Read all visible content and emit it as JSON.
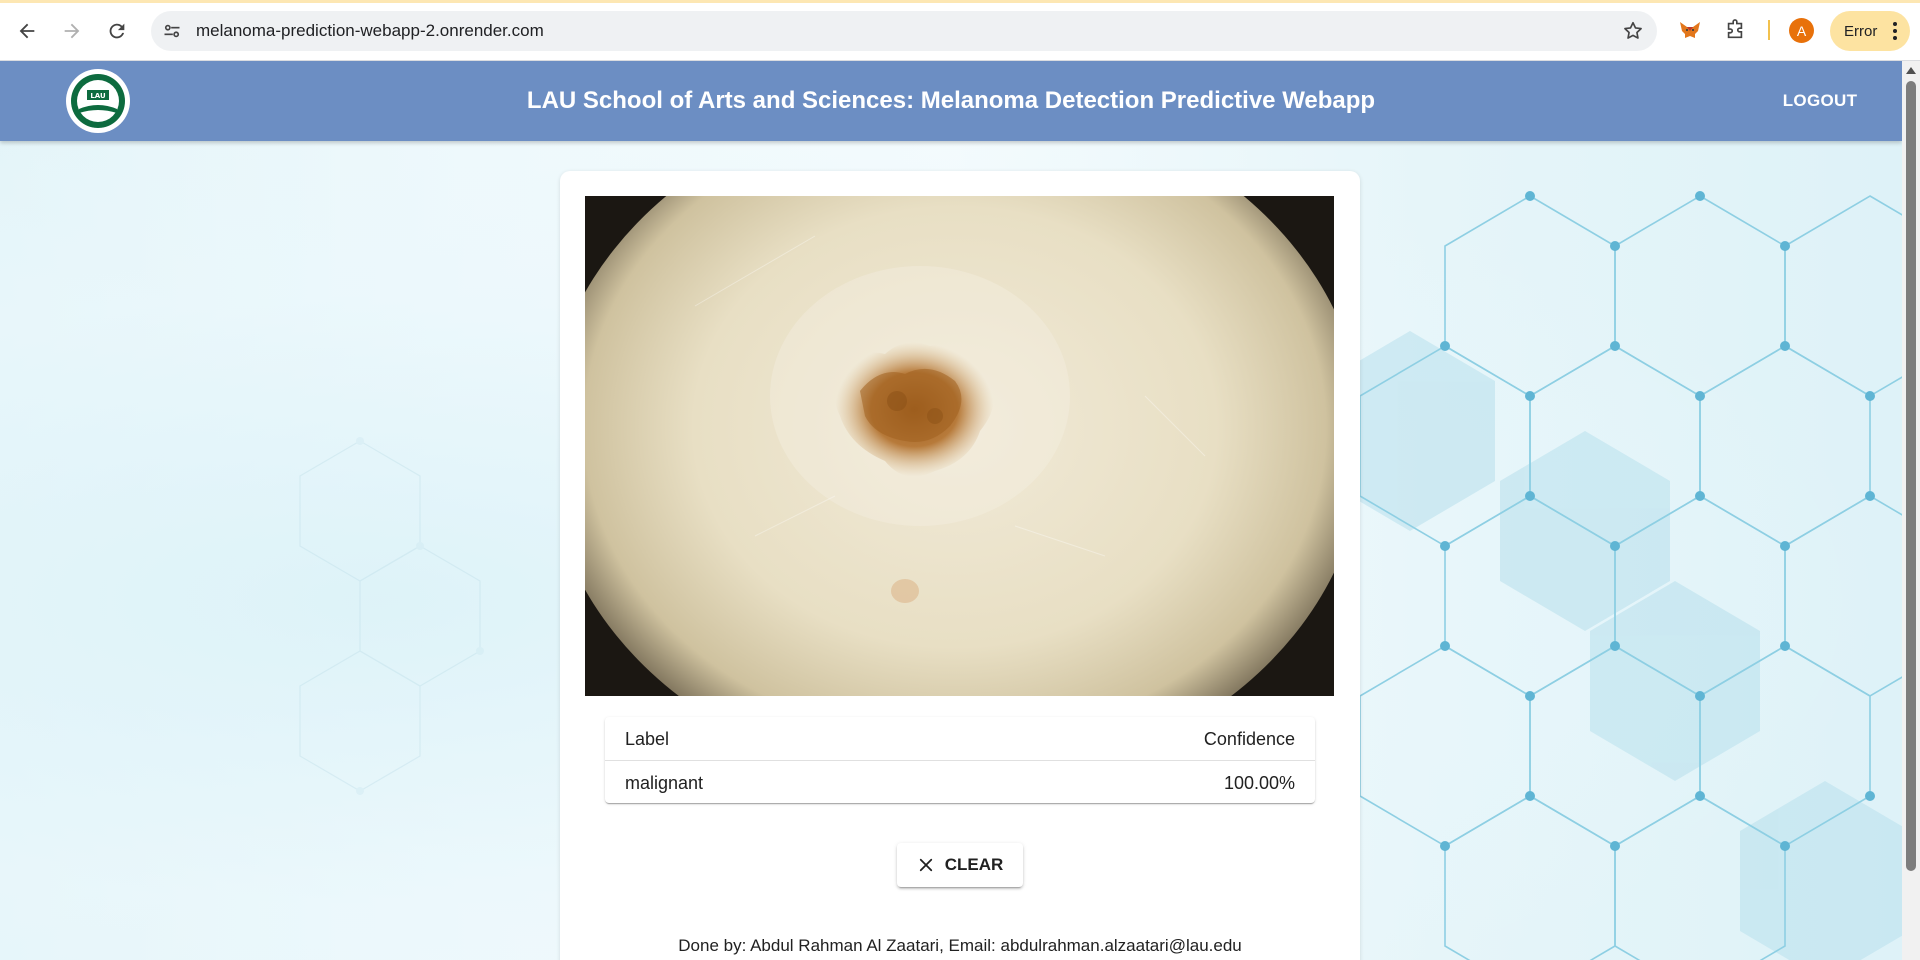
{
  "browser": {
    "url": "melanoma-prediction-webapp-2.onrender.com",
    "profile_initial": "A",
    "error_label": "Error"
  },
  "app": {
    "title": "LAU School of Arts and Sciences: Melanoma Detection Predictive Webapp",
    "logout_label": "LOGOUT",
    "logo_text": "LAU"
  },
  "results": {
    "headers": [
      "Label",
      "Confidence"
    ],
    "rows": [
      {
        "label": "malignant",
        "confidence": "100.00%"
      }
    ]
  },
  "actions": {
    "clear_label": "CLEAR"
  },
  "footer": {
    "credit": "Done by: Abdul Rahman Al Zaatari, Email: abdulrahman.alzaatari@lau.edu"
  },
  "colors": {
    "appbar": "#6c8ec3",
    "hex_lines": "#8ecfe3",
    "lesion": "#a0611f"
  },
  "icons": [
    "back-icon",
    "forward-icon",
    "reload-icon",
    "site-info-icon",
    "star-icon",
    "fox-extension-icon",
    "puzzle-extensions-icon",
    "more-vert-icon",
    "close-icon"
  ]
}
